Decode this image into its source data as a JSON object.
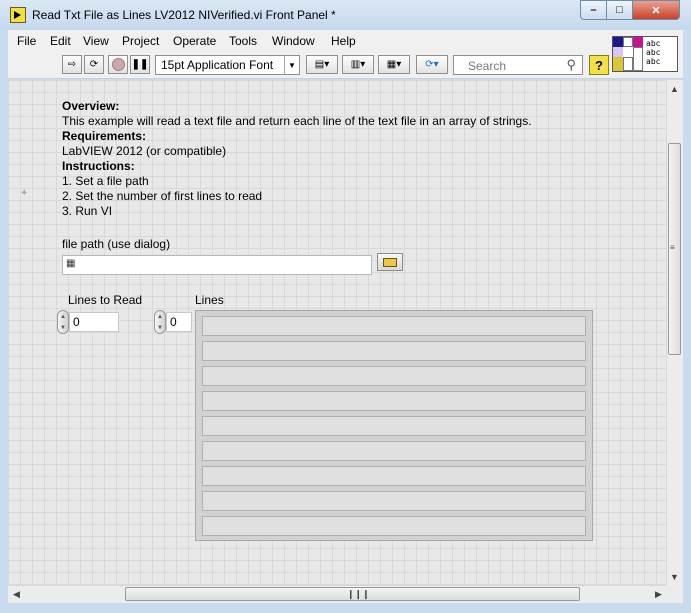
{
  "window": {
    "title": "Read Txt File as Lines LV2012 NIVerified.vi Front Panel *"
  },
  "menu": [
    "File",
    "Edit",
    "View",
    "Project",
    "Operate",
    "Tools",
    "Window",
    "Help"
  ],
  "toolbar": {
    "font_label": "15pt Application Font",
    "search_placeholder": "Search",
    "help_label": "?"
  },
  "icon_pane": {
    "text_lines": [
      "abc",
      "abc",
      "abc"
    ]
  },
  "panel": {
    "overview_heading": "Overview:",
    "overview_text": "This example will read a text file and return each line of the text file in an array of strings.",
    "requirements_heading": "Requirements:",
    "requirements_text": "LabVIEW 2012 (or compatible)",
    "instructions_heading": "Instructions:",
    "instructions": [
      "1. Set a file path",
      "2. Set the number of first lines to read",
      "3. Run VI"
    ],
    "file_path_label": "file path (use dialog)",
    "file_path_value": "",
    "lines_to_read_label": "Lines to Read",
    "lines_to_read_value": "0",
    "lines_label": "Lines",
    "lines_index_value": "0",
    "lines_values": [
      "",
      "",
      "",
      "",
      "",
      "",
      "",
      "",
      ""
    ]
  }
}
